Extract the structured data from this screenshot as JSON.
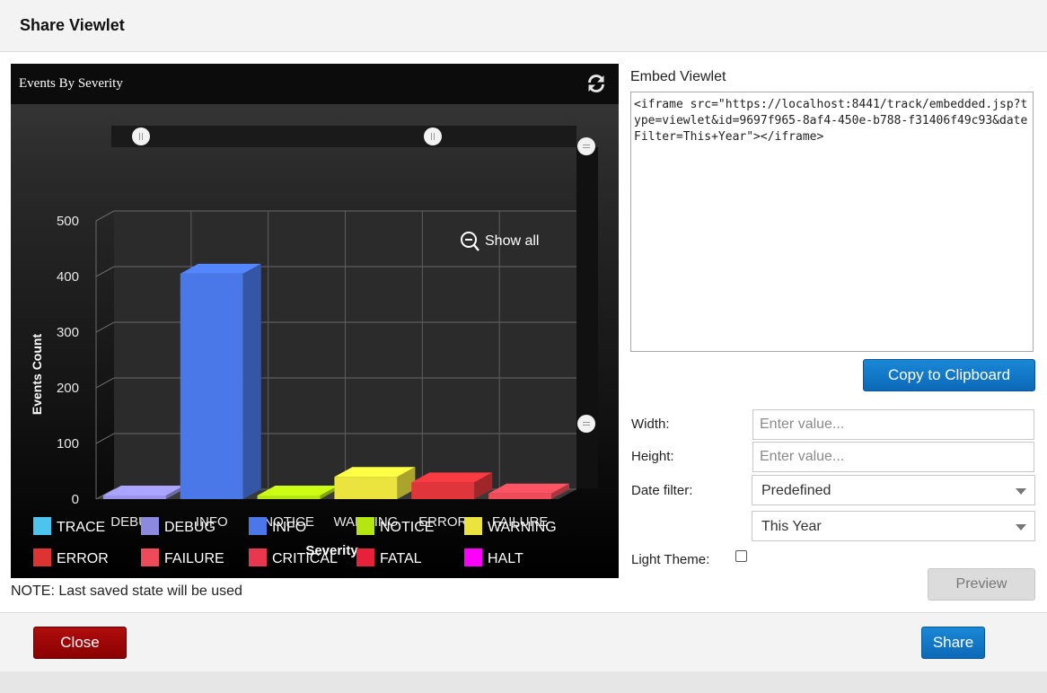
{
  "dialog": {
    "title": "Share Viewlet"
  },
  "chart_panel": {
    "title": "Events By Severity",
    "refresh_icon": "refresh-icon",
    "zoom_label": "Show all",
    "zoom_icon": "zoom-out-icon"
  },
  "chart_data": {
    "type": "bar",
    "title": "Events By Severity",
    "xlabel": "Severity",
    "ylabel": "Events Count",
    "ylim": [
      0,
      500
    ],
    "yticks": [
      "0",
      "100",
      "200",
      "300",
      "400",
      "500"
    ],
    "categories": [
      "DEBUG",
      "INFO",
      "NOTICE",
      "WARNING",
      "ERROR",
      "FAILURE"
    ],
    "values": [
      0,
      405,
      0,
      40,
      30,
      10
    ],
    "colors": [
      "#9a93ea",
      "#4a78e8",
      "#b6e612",
      "#ece43e",
      "#e0353b",
      "#ef4b58"
    ],
    "grid": true,
    "style": "3d",
    "legend_position": "bottom",
    "legend": [
      {
        "name": "TRACE",
        "color": "#4cc4ee"
      },
      {
        "name": "DEBUG",
        "color": "#8c8ae0"
      },
      {
        "name": "INFO",
        "color": "#4a78e8"
      },
      {
        "name": "NOTICE",
        "color": "#b6e612"
      },
      {
        "name": "WARNING",
        "color": "#ece43e"
      },
      {
        "name": "ERROR",
        "color": "#dd3333"
      },
      {
        "name": "FAILURE",
        "color": "#ee4a5a"
      },
      {
        "name": "CRITICAL",
        "color": "#e8374f"
      },
      {
        "name": "FATAL",
        "color": "#e8203a"
      },
      {
        "name": "HALT",
        "color": "#ff00ff"
      }
    ]
  },
  "note": "NOTE: Last saved state will be used",
  "embed": {
    "label": "Embed Viewlet",
    "code": "<iframe src=\"https://localhost:8441/track/embedded.jsp?type=viewlet&id=9697f965-8af4-450e-b788-f31406f49c93&dateFilter=This+Year\"></iframe>",
    "copy_label": "Copy to Clipboard"
  },
  "form": {
    "width_label": "Width:",
    "width_placeholder": "Enter value...",
    "height_label": "Height:",
    "height_placeholder": "Enter value...",
    "date_filter_label": "Date filter:",
    "date_filter_value": "Predefined",
    "period_value": "This Year",
    "light_theme_label": "Light Theme:",
    "light_theme_checked": false,
    "preview_label": "Preview"
  },
  "footer": {
    "close_label": "Close",
    "share_label": "Share"
  },
  "colors": {
    "primary": "#0b6fbf",
    "danger": "#9b0000"
  }
}
